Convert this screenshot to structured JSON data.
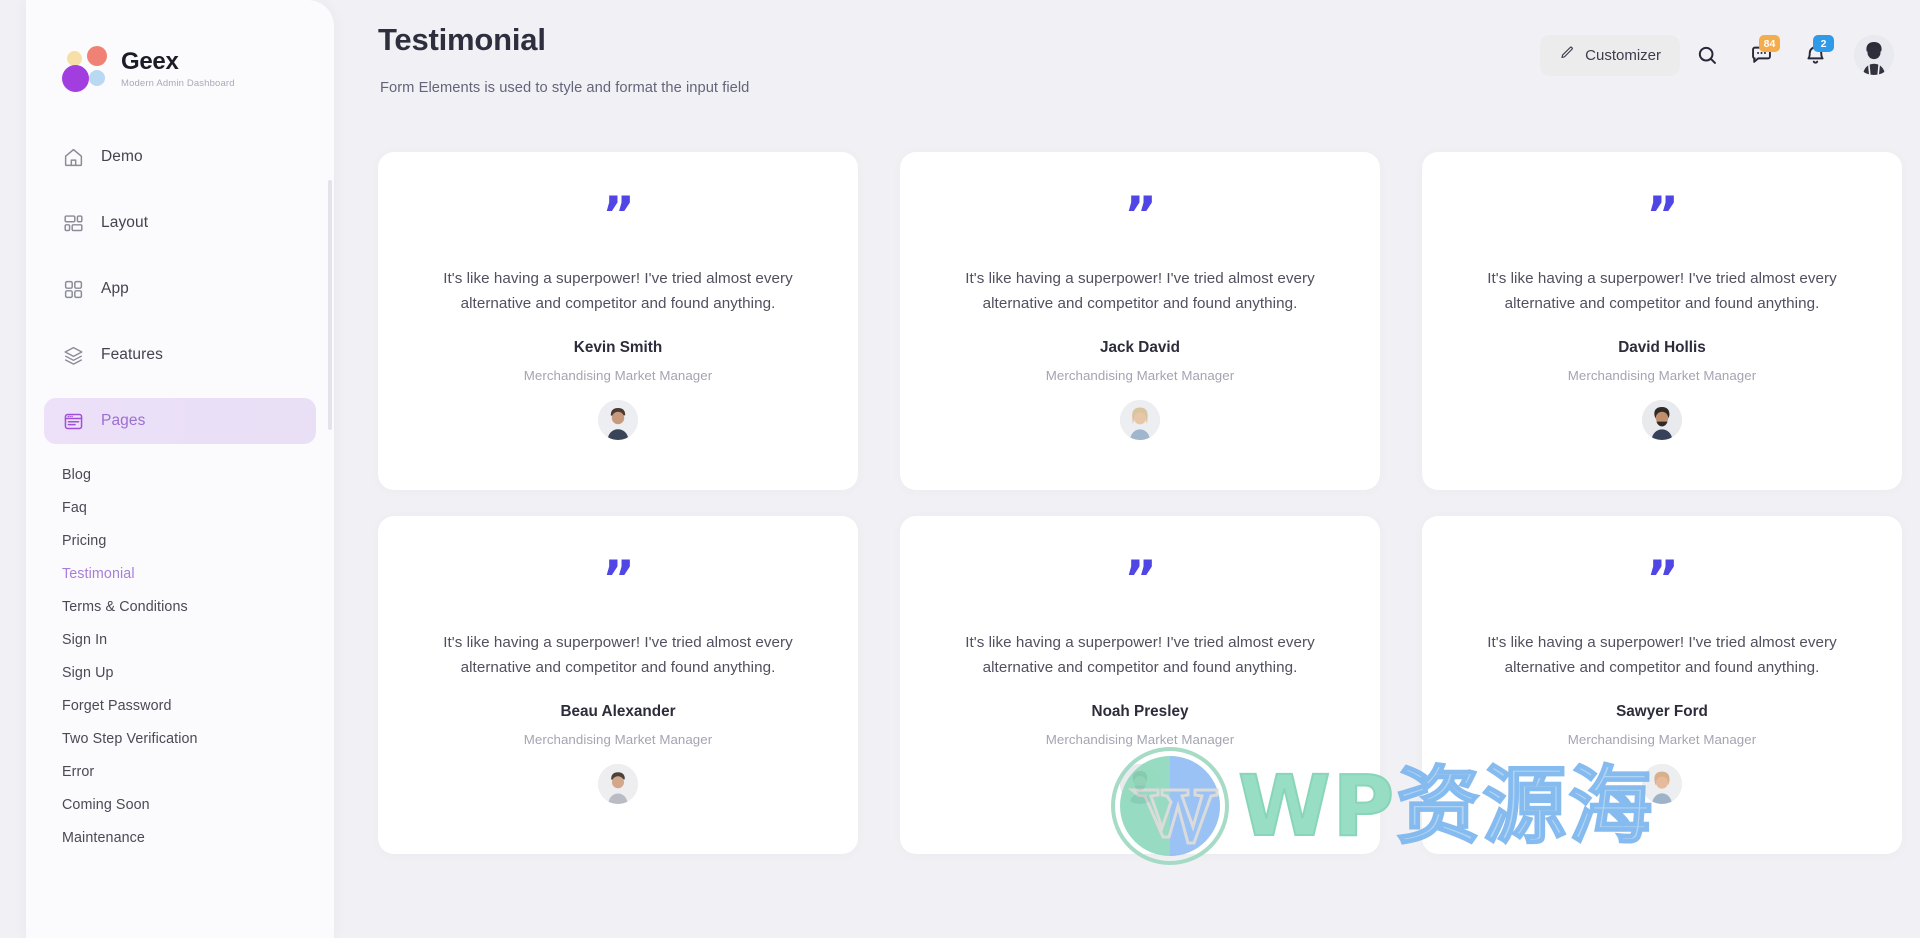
{
  "sidebar": {
    "brand": "Geex",
    "tagline": "Modern Admin Dashboard",
    "nav": [
      {
        "label": "Demo",
        "icon": "home-icon"
      },
      {
        "label": "Layout",
        "icon": "layout-icon"
      },
      {
        "label": "App",
        "icon": "grid-icon"
      },
      {
        "label": "Features",
        "icon": "layers-icon"
      },
      {
        "label": "Pages",
        "icon": "pages-icon",
        "active": true
      }
    ],
    "submenu": [
      {
        "label": "Blog"
      },
      {
        "label": "Faq"
      },
      {
        "label": "Pricing"
      },
      {
        "label": "Testimonial",
        "active": true
      },
      {
        "label": "Terms & Conditions"
      },
      {
        "label": "Sign In"
      },
      {
        "label": "Sign Up"
      },
      {
        "label": "Forget Password"
      },
      {
        "label": "Two Step Verification"
      },
      {
        "label": "Error"
      },
      {
        "label": "Coming Soon"
      },
      {
        "label": "Maintenance"
      }
    ],
    "active_color": "#a87fd6"
  },
  "header": {
    "title": "Testimonial",
    "subtitle": "Form Elements is used to style and format the input field",
    "customizer_label": "Customizer",
    "customizer_icon": "pencil-icon",
    "search_icon": "search-icon",
    "chat_icon": "chat-icon",
    "chat_badge": "84",
    "chat_badge_color": "#f5ac4c",
    "bell_icon": "bell-icon",
    "bell_badge": "2",
    "bell_badge_color": "#2f9ae8",
    "avatar_name": "user-avatar"
  },
  "quote_mark": "”",
  "testimonials": [
    {
      "quote": "It's like having a superpower! I've tried almost every alternative and competitor and found anything.",
      "name": "Kevin Smith",
      "role": "Merchandising Market Manager",
      "avatar_tone": "#4b5a6e"
    },
    {
      "quote": "It's like having a superpower! I've tried almost every alternative and competitor and found anything.",
      "name": "Jack David",
      "role": "Merchandising Market Manager",
      "avatar_tone": "#c9b79a"
    },
    {
      "quote": "It's like having a superpower! I've tried almost every alternative and competitor and found anything.",
      "name": "David Hollis",
      "role": "Merchandising Market Manager",
      "avatar_tone": "#3e4a5c"
    },
    {
      "quote": "It's like having a superpower! I've tried almost every alternative and competitor and found anything.",
      "name": "Beau Alexander",
      "role": "Merchandising Market Manager",
      "avatar_tone": "#8a8f99"
    },
    {
      "quote": "It's like having a superpower! I've tried almost every alternative and competitor and found anything.",
      "name": "Noah Presley",
      "role": "Merchandising Market Manager",
      "avatar_tone": "#3b4656"
    },
    {
      "quote": "It's like having a superpower! I've tried almost every alternative and competitor and found anything.",
      "name": "Sawyer Ford",
      "role": "Merchandising Market Manager",
      "avatar_tone": "#d4a88c"
    }
  ],
  "watermark": {
    "en": "WP",
    "cn": "资源海"
  },
  "colors": {
    "accent": "#4f46e5",
    "page_bg": "#f1f1f5",
    "card_bg": "#ffffff"
  }
}
